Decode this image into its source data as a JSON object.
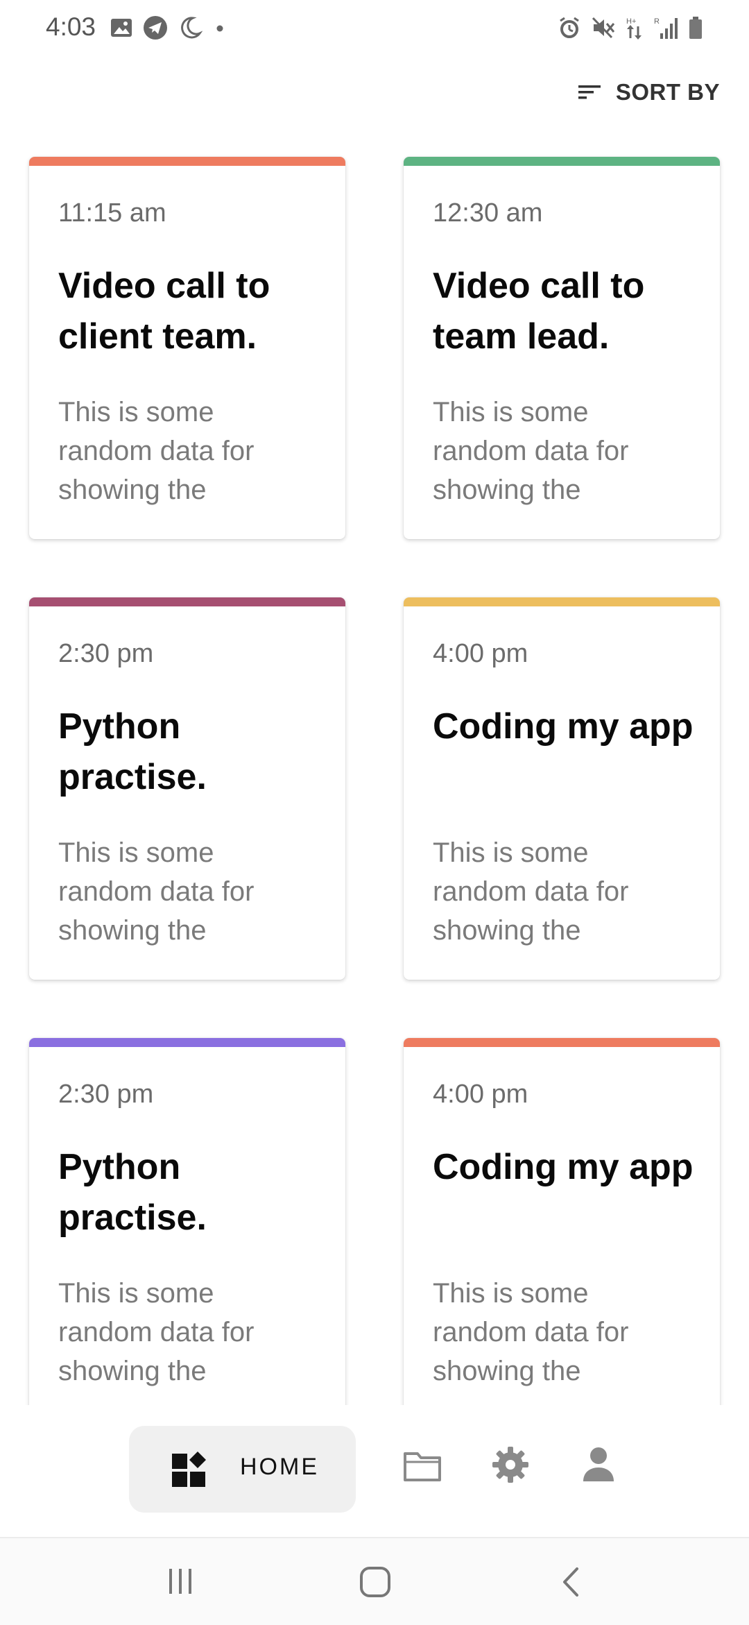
{
  "status_bar": {
    "time": "4:03",
    "left_icons": [
      "gallery-icon",
      "telegram-icon",
      "moon-icon",
      "dot-icon"
    ],
    "right_icons": [
      "alarm-icon",
      "mute-icon",
      "data-arrows-icon",
      "signal-icon",
      "battery-icon"
    ]
  },
  "header": {
    "sort_label": "SORT BY",
    "sort_icon": "sort-icon"
  },
  "cards": [
    {
      "time": "11:15 am",
      "title": "Video call to client team.",
      "description": "This is some random data for showing the",
      "accent": "#EE7B5F"
    },
    {
      "time": "12:30 am",
      "title": "Video call to team lead.",
      "description": "This is some random data for showing the",
      "accent": "#5DB382"
    },
    {
      "time": "2:30 pm",
      "title": "Python practise.",
      "description": "This is some random data for showing the",
      "accent": "#A64F71"
    },
    {
      "time": "4:00 pm",
      "title": "Coding my app",
      "description": "This is some random data for showing the",
      "accent": "#EDBE5E"
    },
    {
      "time": "2:30 pm",
      "title": "Python practise.",
      "description": "This is some random data for showing the",
      "accent": "#8A6FE0"
    },
    {
      "time": "4:00 pm",
      "title": "Coding my app",
      "description": "This is some random data for showing the",
      "accent": "#EE7B5F"
    }
  ],
  "bottom_nav": {
    "home_label": "HOME",
    "items": [
      "home-icon",
      "folder-icon",
      "settings-icon",
      "profile-icon"
    ],
    "active_bg": "#F0F0F0"
  },
  "system_nav": [
    "recents-icon",
    "home-button-icon",
    "back-icon"
  ]
}
